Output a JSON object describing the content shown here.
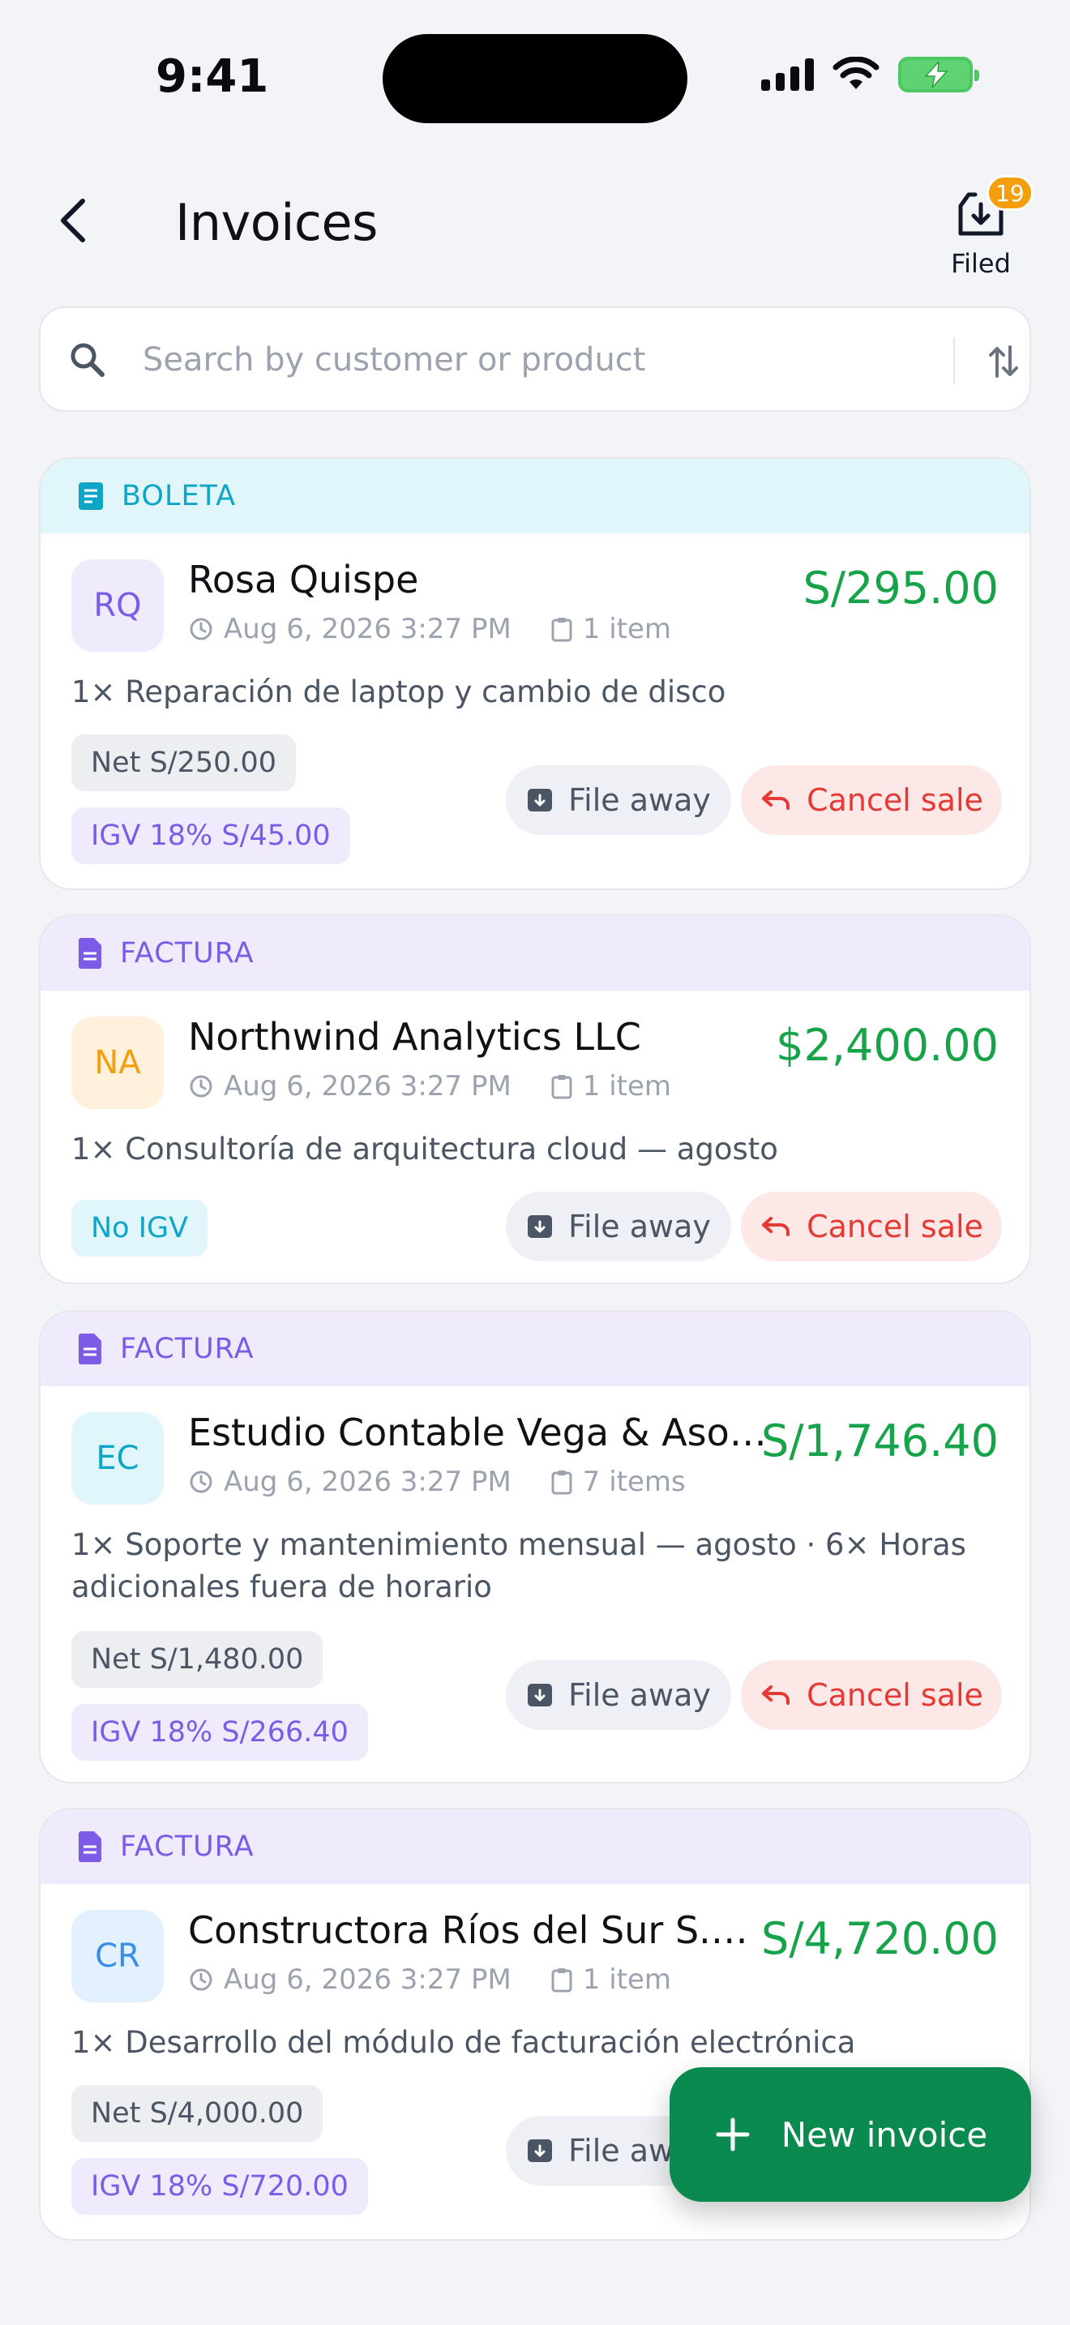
{
  "status": {
    "time": "9:41"
  },
  "header": {
    "title": "Invoices",
    "filed_label": "Filed",
    "filed_count": "19"
  },
  "search": {
    "placeholder": "Search by customer or product"
  },
  "actions": {
    "file_away": "File away",
    "cancel_sale": "Cancel sale",
    "new_invoice": "New invoice"
  },
  "invoices": [
    {
      "type": "BOLETA",
      "initials": "RQ",
      "customer": "Rosa Quispe",
      "amount": "S/295.00",
      "date": "Aug 6, 2026 3:27 PM",
      "items": "1 item",
      "description": "1× Reparación de laptop y cambio de disco",
      "net": "Net S/250.00",
      "tax": "IGV 18% S/45.00"
    },
    {
      "type": "FACTURA",
      "initials": "NA",
      "customer": "Northwind Analytics LLC",
      "amount": "$2,400.00",
      "date": "Aug 6, 2026 3:27 PM",
      "items": "1 item",
      "description": "1× Consultoría de arquitectura cloud — agosto",
      "tax": "No IGV"
    },
    {
      "type": "FACTURA",
      "initials": "EC",
      "customer": "Estudio Contable Vega & Asociados",
      "amount": "S/1,746.40",
      "date": "Aug 6, 2026 3:27 PM",
      "items": "7 items",
      "description": "1× Soporte y mantenimiento mensual — agosto · 6× Horas adicionales fuera de horario",
      "net": "Net S/1,480.00",
      "tax": "IGV 18% S/266.40"
    },
    {
      "type": "FACTURA",
      "initials": "CR",
      "customer": "Constructora Ríos del Sur S.A.C.",
      "amount": "S/4,720.00",
      "date": "Aug 6, 2026 3:27 PM",
      "items": "1 item",
      "description": "1× Desarrollo del módulo de facturación electrónica",
      "net": "Net S/4,000.00",
      "tax": "IGV 18% S/720.00"
    }
  ],
  "colors": {
    "accent_green": "#16a34a",
    "fab": "#0b8a4f",
    "cancel_red": "#e53935",
    "badge": "#f59e0b"
  }
}
